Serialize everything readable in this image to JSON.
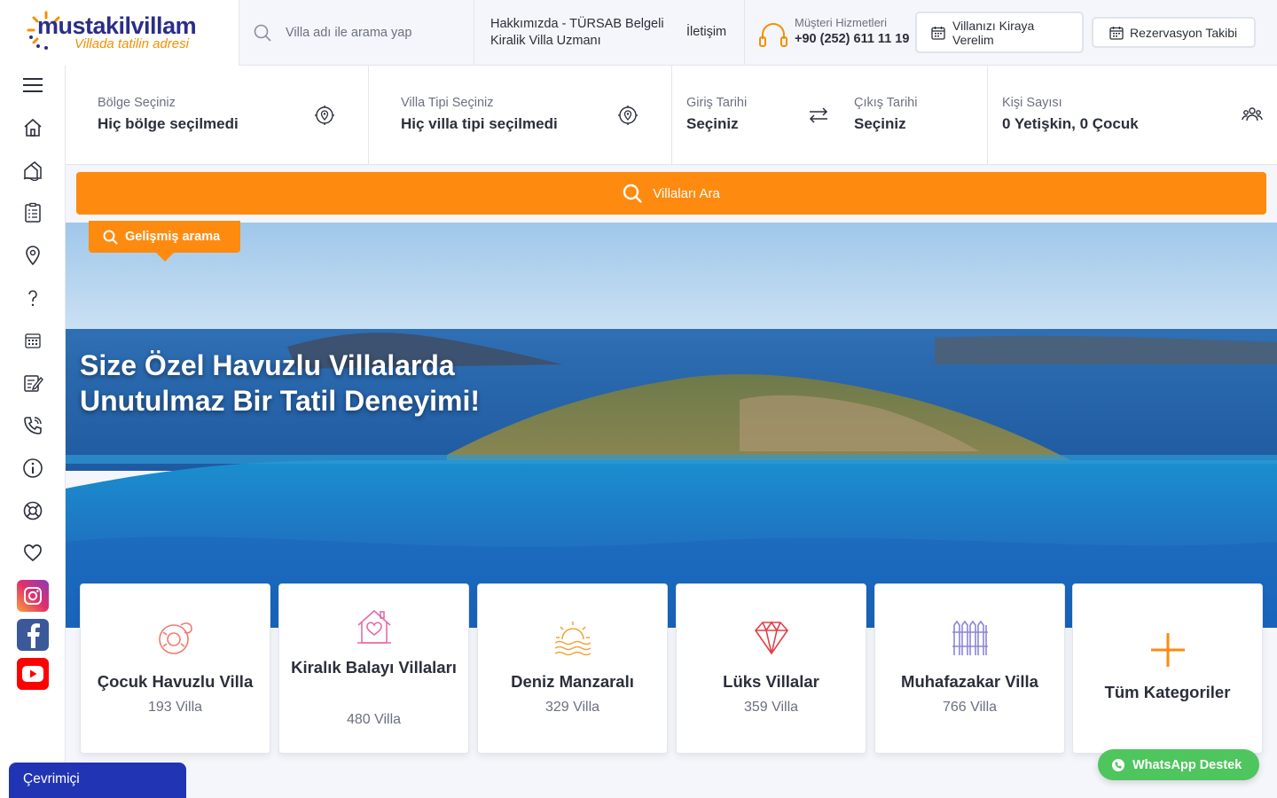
{
  "logo": {
    "brand": "mustakilvillam",
    "tagline": "Villada tatilin adresi"
  },
  "search": {
    "placeholder": "Villa adı ile arama yap"
  },
  "header": {
    "about": "Hakkımızda - TÜRSAB Belgeli Kiralik Villa Uzmanı",
    "contact": "İletişim",
    "support_label": "Müşteri Hizmetleri",
    "support_phone": "+90 (252) 611 11 19",
    "rent_button": "Villanızı Kiraya Verelim",
    "track_button": "Rezervasyon Takibi"
  },
  "sidenav": {
    "icons": [
      "menu-icon",
      "home-icon",
      "villa-icon",
      "list-icon",
      "location-icon",
      "question-icon",
      "calendar-icon",
      "edit-icon",
      "phone-icon",
      "info-icon",
      "support-icon",
      "heart-icon"
    ],
    "social": [
      "instagram-icon",
      "facebook-icon",
      "youtube-icon"
    ]
  },
  "filters": {
    "region_label": "Bölge Seçiniz",
    "region_value": "Hiç bölge seçilmedi",
    "type_label": "Villa Tipi Seçiniz",
    "type_value": "Hiç villa tipi seçilmedi",
    "checkin_label": "Giriş Tarihi",
    "checkin_value": "Seçiniz",
    "checkout_label": "Çıkış Tarihi",
    "checkout_value": "Seçiniz",
    "guests_label": "Kişi Sayısı",
    "guests_value": "0 Yetişkin, 0 Çocuk"
  },
  "search_button": "Villaları Ara",
  "advanced_search": "Gelişmiş arama",
  "hero": {
    "headline_line1": "Size Özel Havuzlu Villalarda",
    "headline_line2": "Unutulmaz Bir Tatil Deneyimi!"
  },
  "categories": [
    {
      "title": "Çocuk Havuzlu Villa",
      "count": "193 Villa",
      "icon": "pool-ring-icon"
    },
    {
      "title": "Kiralık Balayı Villaları",
      "count": "480 Villa",
      "icon": "honeymoon-house-icon"
    },
    {
      "title": "Deniz Manzaralı",
      "count": "329 Villa",
      "icon": "sunset-sea-icon"
    },
    {
      "title": "Lüks Villalar",
      "count": "359 Villa",
      "icon": "diamond-icon"
    },
    {
      "title": "Muhafazakar Villa",
      "count": "766 Villa",
      "icon": "fence-icon"
    },
    {
      "title": "Tüm Kategoriler",
      "count": "",
      "icon": "plus-icon"
    }
  ],
  "chat": {
    "status": "Çevrimiçi",
    "whatsapp": "WhatsApp Destek"
  },
  "colors": {
    "accent": "#fe8b0f",
    "brand_blue": "#2b2d8a",
    "chat_blue": "#2134b3",
    "whatsapp": "#4fc55e"
  }
}
